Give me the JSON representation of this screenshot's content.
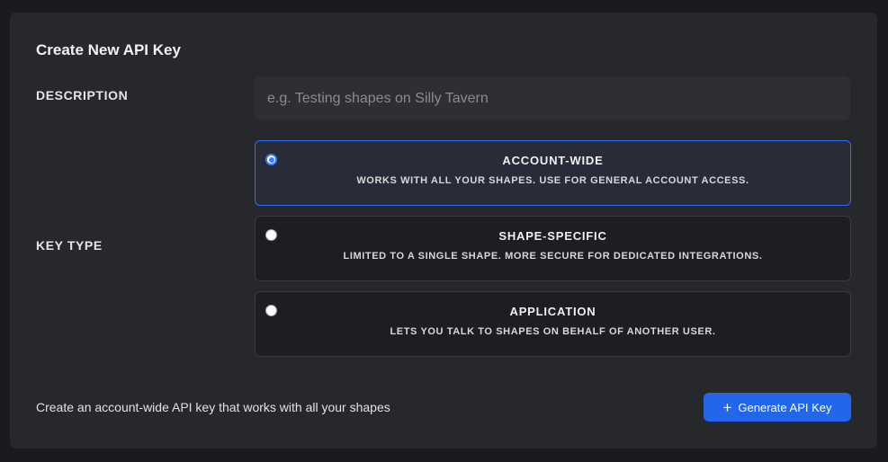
{
  "panel": {
    "title": "Create New API Key"
  },
  "description": {
    "label": "DESCRIPTION",
    "value": "",
    "placeholder": "e.g. Testing shapes on Silly Tavern"
  },
  "key_type": {
    "label": "KEY TYPE",
    "selected": "account-wide",
    "options": [
      {
        "id": "account-wide",
        "title": "ACCOUNT-WIDE",
        "subtitle": "WORKS WITH ALL YOUR SHAPES. USE FOR GENERAL ACCOUNT ACCESS."
      },
      {
        "id": "shape-specific",
        "title": "SHAPE-SPECIFIC",
        "subtitle": "LIMITED TO A SINGLE SHAPE. MORE SECURE FOR DEDICATED INTEGRATIONS."
      },
      {
        "id": "application",
        "title": "APPLICATION",
        "subtitle": "LETS YOU TALK TO SHAPES ON BEHALF OF ANOTHER USER."
      }
    ]
  },
  "footer": {
    "hint": "Create an account-wide API key that works with all your shapes",
    "button_icon": "+",
    "button_label": "Generate API Key"
  },
  "colors": {
    "accent": "#2466ea",
    "panel_bg": "#27282c",
    "selected_bg": "#272c38"
  }
}
